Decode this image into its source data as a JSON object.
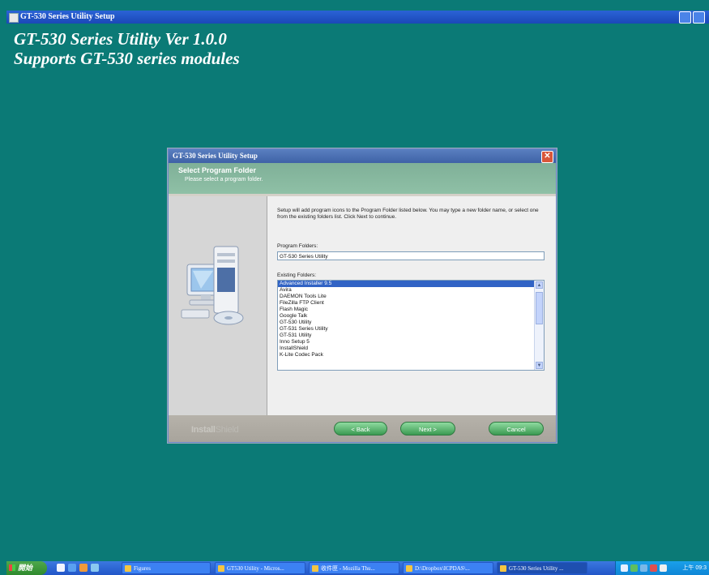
{
  "window": {
    "title": "GT-530 Series Utility Setup"
  },
  "banner": {
    "line1": "GT-530 Series Utility Ver 1.0.0",
    "line2": "Supports GT-530 series modules"
  },
  "dialog": {
    "title": "GT-530 Series Utility Setup",
    "close_label": "✕",
    "header_title": "Select Program Folder",
    "header_subtitle": "Please select a program folder.",
    "description": "Setup will add program icons to the Program Folder listed below.  You may type a new folder name, or select one from the existing folders list.  Click Next to continue.",
    "program_folders_label": "Program Folders:",
    "program_folder_value": "GT-530 Series Utility",
    "existing_folders_label": "Existing Folders:",
    "existing_folders": [
      "Advanced Installer 9.5",
      "Avira",
      "DAEMON Tools Lite",
      "FileZilla FTP Client",
      "Flash Magic",
      "Google Talk",
      "GT-530 Utility",
      "GT-531 Series Utility",
      "GT-531 Utility",
      "Inno Setup 5",
      "InstallShield",
      "K-Lite Codec Pack"
    ],
    "selected_folder": "Advanced Installer 9.5",
    "brand_a": "Install",
    "brand_b": "Shield",
    "back_label": "< Back",
    "next_label": "Next >",
    "cancel_label": "Cancel"
  },
  "taskbar": {
    "start_label": "開始",
    "tasks": [
      "Figures",
      "GT530 Utility - Micros...",
      "收件匣 - Mozilla Thu...",
      "D:\\Dropbox\\ICPDAS\\...",
      "GT-530 Series Utility ..."
    ],
    "clock": "上午 09:3"
  }
}
